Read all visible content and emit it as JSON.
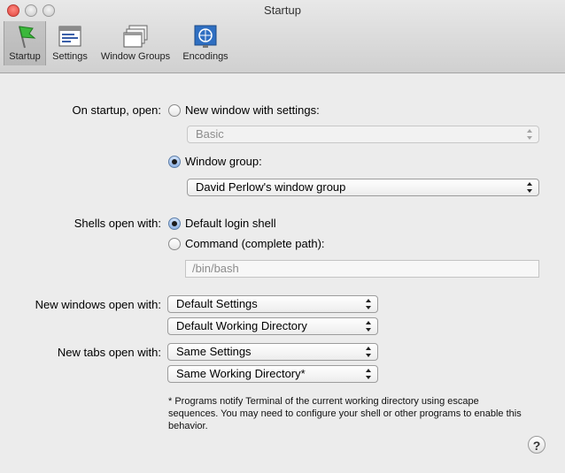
{
  "window": {
    "title": "Startup"
  },
  "toolbar": {
    "items": [
      {
        "label": "Startup",
        "icon": "startup-flag-icon"
      },
      {
        "label": "Settings",
        "icon": "settings-icon"
      },
      {
        "label": "Window Groups",
        "icon": "window-groups-icon"
      },
      {
        "label": "Encodings",
        "icon": "encodings-icon"
      }
    ],
    "selected": "Startup"
  },
  "startup": {
    "label": "On startup, open:",
    "new_window_option": "New window with settings:",
    "new_window_selected": false,
    "settings_popup": "Basic",
    "window_group_option": "Window group:",
    "window_group_selected": true,
    "window_group_popup": "David Perlow's window group"
  },
  "shells": {
    "label": "Shells open with:",
    "default_option": "Default login shell",
    "default_selected": true,
    "command_option": "Command (complete path):",
    "command_selected": false,
    "command_placeholder": "/bin/bash"
  },
  "new_windows": {
    "label": "New windows open with:",
    "settings_popup": "Default Settings",
    "directory_popup": "Default Working Directory"
  },
  "new_tabs": {
    "label": "New tabs open with:",
    "settings_popup": "Same Settings",
    "directory_popup": "Same Working Directory*"
  },
  "footnote": "* Programs notify Terminal of the current working directory using escape sequences. You may need to configure your shell or other programs to enable this behavior.",
  "help": {
    "label": "?"
  }
}
